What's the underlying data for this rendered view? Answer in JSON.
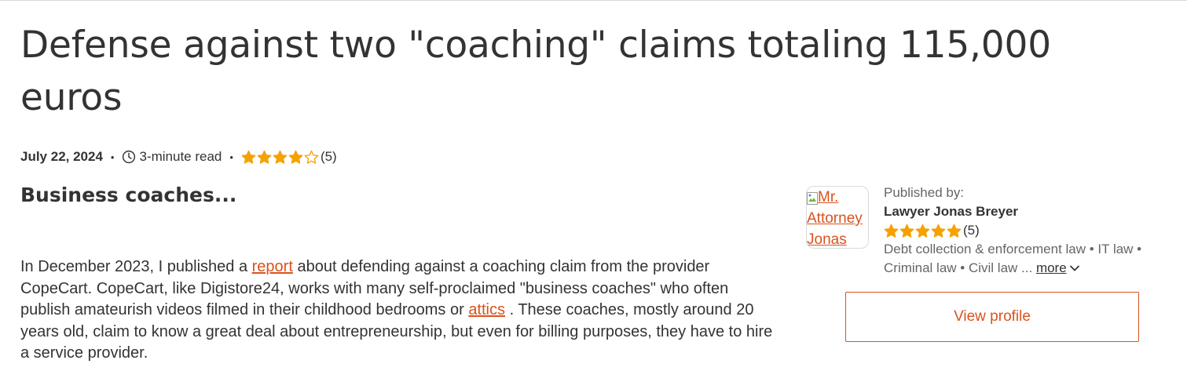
{
  "article": {
    "title": "Defense against two \"coaching\" claims totaling 115,000 euros",
    "date": "July 22, 2024",
    "read_time": "3-minute read",
    "rating": {
      "stars": 4,
      "max": 5,
      "count": "(5)"
    },
    "subtitle": "Business coaches...",
    "body": {
      "p1": "In December 2023, I published a",
      "link1": "report",
      "p2": "about defending against a coaching claim from the provider CopeCart. CopeCart, like Digistore24, works with many self-proclaimed \"business coaches\" who often publish amateurish videos filmed in their childhood bedrooms or",
      "link2": "attics",
      "p3": ". These coaches, mostly around 20 years old, claim to know a great deal about entrepreneurship, but even for billing purposes, they have to hire a service provider."
    }
  },
  "author": {
    "avatar_alt": "Mr. Attorney Jonas",
    "published_by": "Published by:",
    "name": "Lawyer Jonas Breyer",
    "rating": {
      "stars": 5,
      "max": 5,
      "count": "(5)"
    },
    "categories": "Debt collection & enforcement law • IT law • Criminal law • Civil law ...",
    "more": "more",
    "view_profile": "View profile"
  },
  "colors": {
    "accent": "#d9531e",
    "star": "#f5a200",
    "text": "#333333",
    "muted": "#666666"
  },
  "icons": [
    "clock-icon",
    "star-icon",
    "broken-image-icon",
    "chevron-down-icon"
  ]
}
